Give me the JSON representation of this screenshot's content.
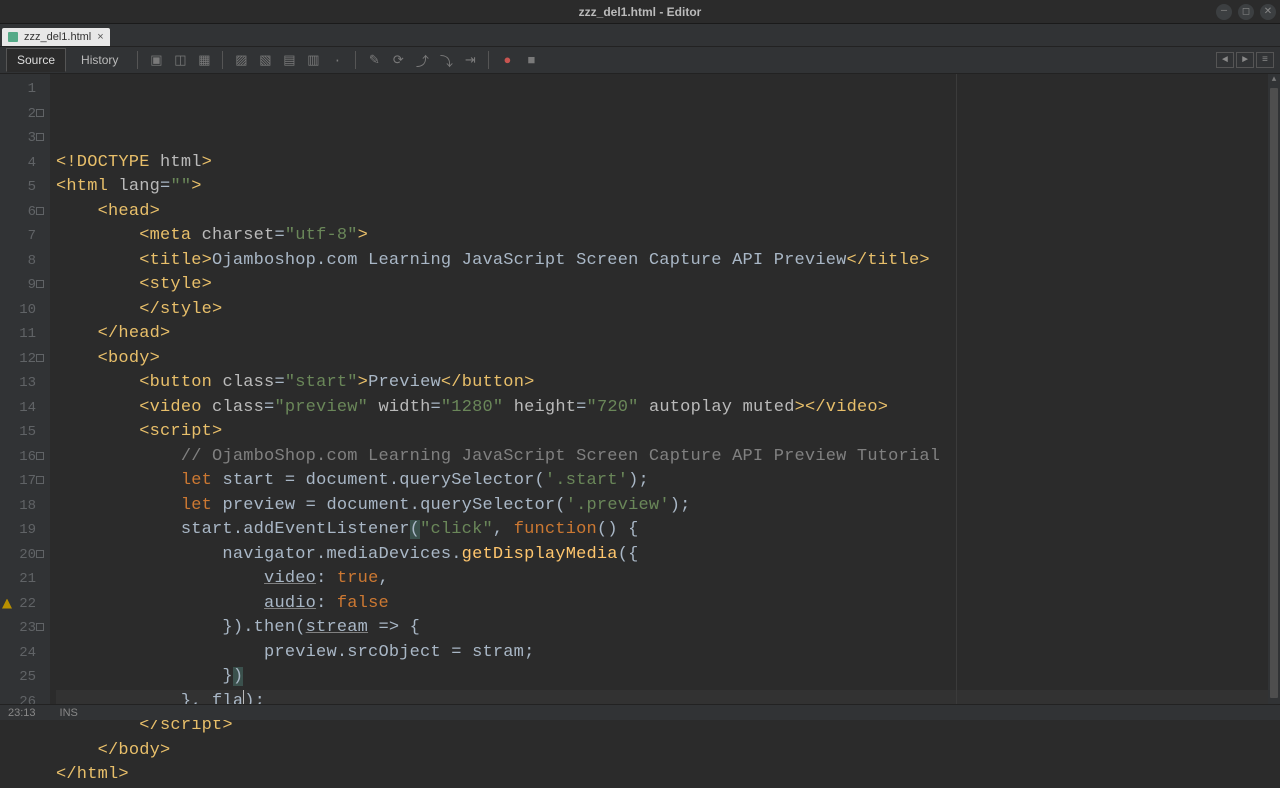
{
  "window": {
    "title": "zzz_del1.html - Editor"
  },
  "file_tab": {
    "name": "zzz_del1.html"
  },
  "view_tabs": {
    "source": "Source",
    "history": "History"
  },
  "code": {
    "lines": [
      [
        {
          "t": "<!DOCTYPE ",
          "c": "tag"
        },
        {
          "t": "html",
          "c": "attr"
        },
        {
          "t": ">",
          "c": "tag"
        }
      ],
      [
        {
          "t": "<html ",
          "c": "tag"
        },
        {
          "t": "lang",
          "c": "attr"
        },
        {
          "t": "=",
          "c": "default"
        },
        {
          "t": "\"\"",
          "c": "string"
        },
        {
          "t": ">",
          "c": "tag"
        }
      ],
      [
        {
          "t": "    ",
          "c": "default"
        },
        {
          "t": "<head>",
          "c": "tag"
        }
      ],
      [
        {
          "t": "        ",
          "c": "default"
        },
        {
          "t": "<meta ",
          "c": "tag"
        },
        {
          "t": "charset",
          "c": "attr"
        },
        {
          "t": "=",
          "c": "default"
        },
        {
          "t": "\"utf-8\"",
          "c": "string"
        },
        {
          "t": ">",
          "c": "tag"
        }
      ],
      [
        {
          "t": "        ",
          "c": "default"
        },
        {
          "t": "<title>",
          "c": "tag"
        },
        {
          "t": "Ojamboshop.com Learning JavaScript Screen Capture API Preview",
          "c": "default"
        },
        {
          "t": "</title>",
          "c": "tag"
        }
      ],
      [
        {
          "t": "        ",
          "c": "default"
        },
        {
          "t": "<style>",
          "c": "tag"
        }
      ],
      [
        {
          "t": "        ",
          "c": "default"
        },
        {
          "t": "</style>",
          "c": "tag"
        }
      ],
      [
        {
          "t": "    ",
          "c": "default"
        },
        {
          "t": "</head>",
          "c": "tag"
        }
      ],
      [
        {
          "t": "    ",
          "c": "default"
        },
        {
          "t": "<body>",
          "c": "tag"
        }
      ],
      [
        {
          "t": "        ",
          "c": "default"
        },
        {
          "t": "<button ",
          "c": "tag"
        },
        {
          "t": "class",
          "c": "attr"
        },
        {
          "t": "=",
          "c": "default"
        },
        {
          "t": "\"start\"",
          "c": "string"
        },
        {
          "t": ">",
          "c": "tag"
        },
        {
          "t": "Preview",
          "c": "default"
        },
        {
          "t": "</button>",
          "c": "tag"
        }
      ],
      [
        {
          "t": "        ",
          "c": "default"
        },
        {
          "t": "<video ",
          "c": "tag"
        },
        {
          "t": "class",
          "c": "attr"
        },
        {
          "t": "=",
          "c": "default"
        },
        {
          "t": "\"preview\" ",
          "c": "string"
        },
        {
          "t": "width",
          "c": "attr"
        },
        {
          "t": "=",
          "c": "default"
        },
        {
          "t": "\"1280\" ",
          "c": "string"
        },
        {
          "t": "height",
          "c": "attr"
        },
        {
          "t": "=",
          "c": "default"
        },
        {
          "t": "\"720\" ",
          "c": "string"
        },
        {
          "t": "autoplay muted",
          "c": "attr"
        },
        {
          "t": ">",
          "c": "tag"
        },
        {
          "t": "</video>",
          "c": "tag"
        }
      ],
      [
        {
          "t": "        ",
          "c": "default"
        },
        {
          "t": "<script>",
          "c": "tag"
        }
      ],
      [
        {
          "t": "            ",
          "c": "default"
        },
        {
          "t": "// OjamboShop.com Learning JavaScript Screen Capture API Preview Tutorial",
          "c": "comment"
        }
      ],
      [
        {
          "t": "            ",
          "c": "default"
        },
        {
          "t": "let",
          "c": "keyword"
        },
        {
          "t": " start = document.querySelector(",
          "c": "default"
        },
        {
          "t": "'.start'",
          "c": "string"
        },
        {
          "t": ");",
          "c": "default"
        }
      ],
      [
        {
          "t": "            ",
          "c": "default"
        },
        {
          "t": "let",
          "c": "keyword"
        },
        {
          "t": " preview = document.querySelector(",
          "c": "default"
        },
        {
          "t": "'.preview'",
          "c": "string"
        },
        {
          "t": ");",
          "c": "default"
        }
      ],
      [
        {
          "t": "            start.addEventListener",
          "c": "default"
        },
        {
          "t": "(",
          "c": "parenmatch"
        },
        {
          "t": "\"click\"",
          "c": "string"
        },
        {
          "t": ", ",
          "c": "default"
        },
        {
          "t": "function",
          "c": "keyword"
        },
        {
          "t": "() {",
          "c": "default"
        }
      ],
      [
        {
          "t": "                navigator.mediaDevices.",
          "c": "default"
        },
        {
          "t": "getDisplayMedia",
          "c": "func"
        },
        {
          "t": "({",
          "c": "default"
        }
      ],
      [
        {
          "t": "                    ",
          "c": "default"
        },
        {
          "t": "video",
          "c": "underline"
        },
        {
          "t": ": ",
          "c": "default"
        },
        {
          "t": "true",
          "c": "keyword"
        },
        {
          "t": ",",
          "c": "default"
        }
      ],
      [
        {
          "t": "                    ",
          "c": "default"
        },
        {
          "t": "audio",
          "c": "underline"
        },
        {
          "t": ": ",
          "c": "default"
        },
        {
          "t": "false",
          "c": "keyword"
        }
      ],
      [
        {
          "t": "                }).then(",
          "c": "default"
        },
        {
          "t": "stream",
          "c": "underline"
        },
        {
          "t": " => {",
          "c": "default"
        }
      ],
      [
        {
          "t": "                    preview.srcObject = stram;",
          "c": "default"
        }
      ],
      [
        {
          "t": "                }",
          "c": "default"
        },
        {
          "t": ")",
          "c": "parenmatch"
        }
      ],
      [
        {
          "t": "            }, fla",
          "c": "default"
        },
        {
          "t": "|",
          "c": "cursor"
        },
        {
          "t": ");",
          "c": "default"
        }
      ],
      [
        {
          "t": "        ",
          "c": "default"
        },
        {
          "t": "</script>",
          "c": "tag"
        }
      ],
      [
        {
          "t": "    ",
          "c": "default"
        },
        {
          "t": "</body>",
          "c": "tag"
        }
      ],
      [
        {
          "t": "</html>",
          "c": "tag"
        }
      ]
    ],
    "current_line_index": 22,
    "warning_line_index": 21
  },
  "statusbar": {
    "pos": "23:13",
    "mode": "INS"
  }
}
